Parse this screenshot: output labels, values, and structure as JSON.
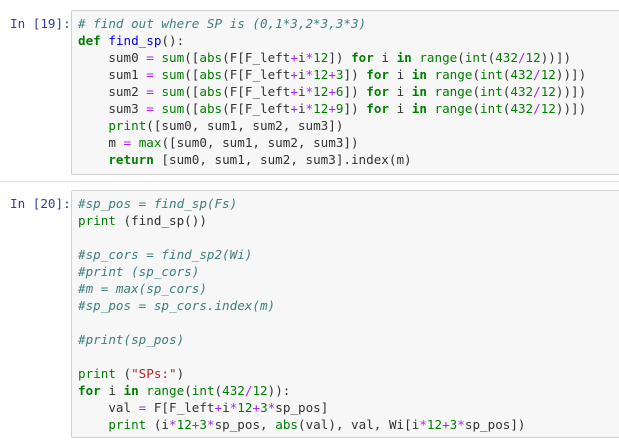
{
  "cells": [
    {
      "prompt": "In [19]:",
      "lines": [
        "# find out where SP is (0,1*3,2*3,3*3)",
        "def find_sp():",
        "    sum0 = sum([abs(F[F_left+i*12]) for i in range(int(432/12))])",
        "    sum1 = sum([abs(F[F_left+i*12+3]) for i in range(int(432/12))])",
        "    sum2 = sum([abs(F[F_left+i*12+6]) for i in range(int(432/12))])",
        "    sum3 = sum([abs(F[F_left+i*12+9]) for i in range(int(432/12))])",
        "    print([sum0, sum1, sum2, sum3])",
        "    m = max([sum0, sum1, sum2, sum3])",
        "    return [sum0, sum1, sum2, sum3].index(m)"
      ]
    },
    {
      "prompt": "In [20]:",
      "lines": [
        "#sp_pos = find_sp(Fs)",
        "print (find_sp())",
        "",
        "#sp_cors = find_sp2(Wi)",
        "#print (sp_cors)",
        "#m = max(sp_cors)",
        "#sp_pos = sp_cors.index(m)",
        "",
        "#print(sp_pos)",
        "",
        "print (\"SPs:\")",
        "for i in range(int(432/12)):",
        "    val = F[F_left+i*12+3*sp_pos]",
        "    print (i*12+3*sp_pos, abs(val), val, Wi[i*12+3*sp_pos])"
      ]
    }
  ]
}
